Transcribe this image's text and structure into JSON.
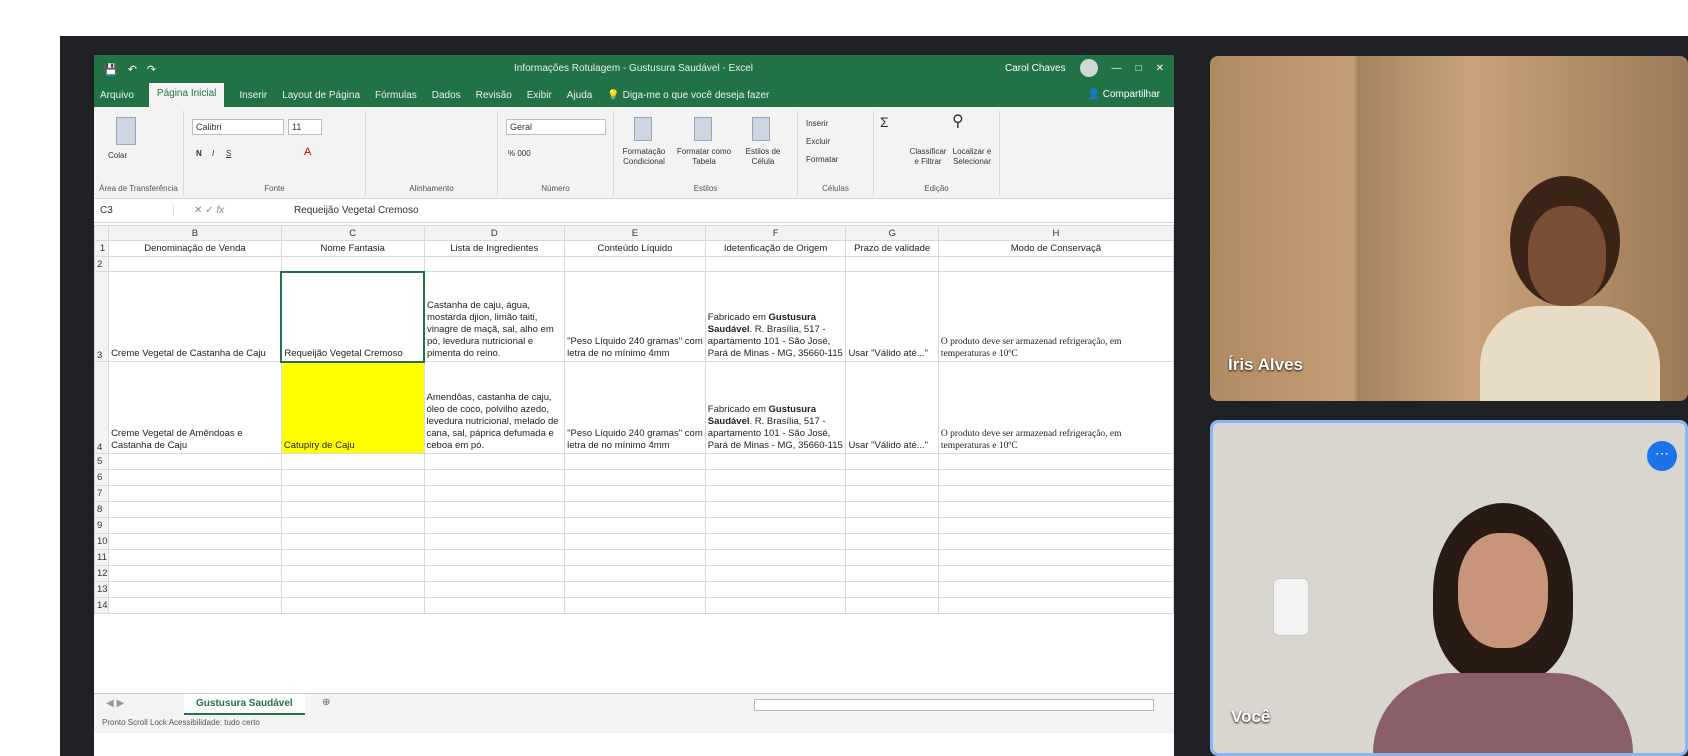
{
  "excel": {
    "title": "Informações Rotulagem - Gustusura Saudável - Excel",
    "user": "Carol Chaves",
    "menu": [
      "Arquivo",
      "Página Inicial",
      "Inserir",
      "Layout de Página",
      "Fórmulas",
      "Dados",
      "Revisão",
      "Exibir",
      "Ajuda",
      "Diga-me o que você deseja fazer"
    ],
    "share": "Compartilhar",
    "ribbon": {
      "paste": "Colar",
      "clipboard": "Área de Transferência",
      "font_name": "Calibri",
      "font_size": "11",
      "font_group": "Fonte",
      "align_group": "Alinhamento",
      "number_format": "Geral",
      "number_group": "Número",
      "cond_format": "Formatação Condicional",
      "format_table": "Formatar como Tabela",
      "cell_styles": "Estilos de Célula",
      "styles_group": "Estilos",
      "insert": "Inserir",
      "delete": "Excluir",
      "format": "Formatar",
      "cells_group": "Células",
      "sort_filter": "Classificar e Filtrar",
      "find_select": "Localizar e Selecionar",
      "edit_group": "Edição"
    },
    "name_box": "C3",
    "formula": "Requeijão Vegetal Cremoso",
    "columns": [
      "B",
      "C",
      "D",
      "E",
      "F",
      "G",
      "H"
    ],
    "header_row": [
      "Denominação de Venda",
      "Nome Fantasia",
      "Lista de Ingredientes",
      "Conteúdo Líquido",
      "Idetenficação de Origem",
      "Prazo de validade",
      "Modo de Conservaçã"
    ],
    "rows": [
      {
        "num": "3",
        "b": "Creme Vegetal de Castanha de Caju",
        "c": "Requeijão Vegetal Cremoso",
        "d": "Castanha de caju, água, mostarda djion, limão taiti, vinagre de maçã, sal, alho em pó, levedura nutricional e pimenta do reino.",
        "e": "\"Peso Líquido 240 gramas\" com letra de no mínimo 4mm",
        "f_pre": "Fabricado em ",
        "f_bold": "Gustusura Saudável",
        "f_post": ". R. Brasília, 517 - apartamento 101 - São José, Pará de Minas - MG, 35660-115",
        "g": "Usar \"Válido até...\"",
        "h": "O produto deve ser armazenad refrigeração, em temperaturas e 10ºC"
      },
      {
        "num": "4",
        "b": "Creme Vegetal de Amêndoas e Castanha de Caju",
        "c": "Catupiry de Caju",
        "d": "Amendôas, castanha de caju, óleo de coco, polvilho azedo, levedura nutricional, melado de cana, sal, páprica defumada e ceboa em pó.",
        "e": "\"Peso Líquido 240 gramas\" com letra de no mínimo 4mm",
        "f_pre": "Fabricado em ",
        "f_bold": "Gustusura Saudável",
        "f_post": ". R. Brasília, 517 - apartamento 101 - São José, Pará de Minas - MG, 35660-115",
        "g": "Usar \"Válido até...\"",
        "h": "O produto deve ser armazenad refrigeração, em temperaturas e 10ºC"
      }
    ],
    "empty_rows": [
      "5",
      "6",
      "7",
      "8",
      "9",
      "10",
      "11",
      "12",
      "13",
      "14"
    ],
    "sheet_tab": "Gustusura Saudável",
    "status": "Pronto    Scroll Lock    Acessibilidade: tudo certo"
  },
  "participants": [
    {
      "name": "Íris Alves"
    },
    {
      "name": "Você"
    }
  ],
  "colors": {
    "excel_green": "#217346",
    "highlight": "#ffff00",
    "meet_blue": "#1a73e8"
  }
}
